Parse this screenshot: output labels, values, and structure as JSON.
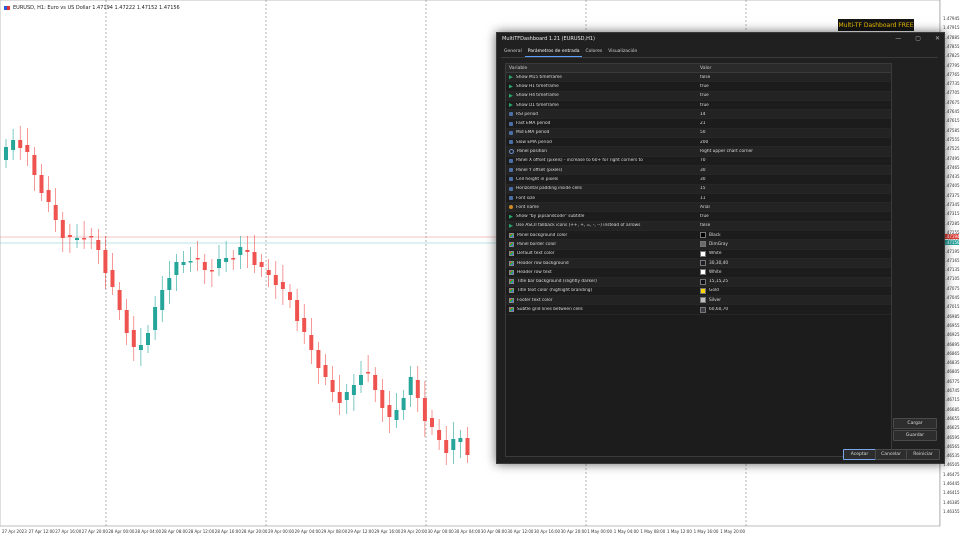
{
  "chart": {
    "header": "EURUSD, H1: Euro vs US Dollar  1.47194  1.47222  1.47152  1.47156",
    "promo": "Multi-TF Dashboard FREE",
    "price_labels": [
      "1.47945",
      "1.47915",
      "1.47885",
      "1.47855",
      "1.47825",
      "1.47795",
      "1.47765",
      "1.47735",
      "1.47705",
      "1.47675",
      "1.47645",
      "1.47615",
      "1.47585",
      "1.47555",
      "1.47525",
      "1.47495",
      "1.47465",
      "1.47435",
      "1.47405",
      "1.47375",
      "1.47345",
      "1.47315",
      "1.47285",
      "1.47255",
      "1.47225",
      "1.47195",
      "1.47165",
      "1.47135",
      "1.47105",
      "1.47075",
      "1.47045",
      "1.47015",
      "1.46985",
      "1.46955",
      "1.46925",
      "1.46895",
      "1.46865",
      "1.46835",
      "1.46805",
      "1.46775",
      "1.46745",
      "1.46715",
      "1.46685",
      "1.46655",
      "1.46625",
      "1.46595",
      "1.46565",
      "1.46535",
      "1.46505",
      "1.46475",
      "1.46445",
      "1.46415",
      "1.46385",
      "1.46355"
    ],
    "price_tags": [
      {
        "text": "1.47194",
        "color": "#e0403a"
      },
      {
        "text": "1.47156",
        "color": "#2aa6a0"
      }
    ],
    "time_labels": [
      "27 Apr 2023",
      "27 Apr 12:00",
      "27 Apr 16:00",
      "27 Apr 20:00",
      "28 Apr 00:00",
      "28 Apr 04:00",
      "28 Apr 08:00",
      "28 Apr 12:00",
      "28 Apr 16:00",
      "28 Apr 20:00",
      "29 Apr 00:00",
      "29 Apr 04:00",
      "29 Apr 08:00",
      "29 Apr 12:00",
      "29 Apr 16:00",
      "29 Apr 20:00",
      "30 Apr 00:00",
      "30 Apr 04:00",
      "30 Apr 08:00",
      "30 Apr 12:00",
      "30 Apr 16:00",
      "30 Apr 20:00",
      "1 May 00:00",
      "1 May 04:00",
      "1 May 08:00",
      "1 May 12:00",
      "1 May 16:00",
      "1 May 20:00"
    ],
    "colors": {
      "bull": "#26a69a",
      "bear": "#ef5350"
    }
  },
  "dialog": {
    "title": "MultiTFDashboard 1.21 (EURUSD,H1)",
    "controls": {
      "minimize": "—",
      "maximize": "▢",
      "close": "✕"
    },
    "tabs": [
      {
        "label": "General",
        "active": false
      },
      {
        "label": "Parámetros de entrada",
        "active": true
      },
      {
        "label": "Colores",
        "active": false
      },
      {
        "label": "Visualización",
        "active": false
      }
    ],
    "columns": {
      "variable": "Variable",
      "value": "Valor"
    },
    "rows": [
      {
        "name": "Show M15 timeframe",
        "value": "false",
        "icon": "bool"
      },
      {
        "name": "Show H1 timeframe",
        "value": "true",
        "icon": "bool"
      },
      {
        "name": "Show H4 timeframe",
        "value": "true",
        "icon": "bool"
      },
      {
        "name": "Show D1 timeframe",
        "value": "true",
        "icon": "bool"
      },
      {
        "name": "RSI period",
        "value": "14",
        "icon": "int"
      },
      {
        "name": "Fast EMA period",
        "value": "21",
        "icon": "int"
      },
      {
        "name": "Mid EMA period",
        "value": "50",
        "icon": "int"
      },
      {
        "name": "Slow EMA period",
        "value": "200",
        "icon": "int"
      },
      {
        "name": "Panel position",
        "value": "Right upper chart corner",
        "icon": "enum"
      },
      {
        "name": "Panel X offset (pixels) - increase to 60+ for right corners to",
        "value": "70",
        "icon": "int"
      },
      {
        "name": "Panel Y offset (pixels)",
        "value": "30",
        "icon": "int"
      },
      {
        "name": "Cell height in pixels",
        "value": "30",
        "icon": "int"
      },
      {
        "name": "Horizontal padding inside cells",
        "value": "15",
        "icon": "int"
      },
      {
        "name": "Font size",
        "value": "11",
        "icon": "int"
      },
      {
        "name": "Font name",
        "value": "Arial",
        "icon": "str"
      },
      {
        "name": "Show \"by pipsandcode\" subtitle",
        "value": "true",
        "icon": "bool"
      },
      {
        "name": "Use ASCII fallback icons (++, +, =, -, --) instead of arrows",
        "value": "false",
        "icon": "bool"
      },
      {
        "name": "Panel background color",
        "value": "Black",
        "icon": "color",
        "swatch": "#000000"
      },
      {
        "name": "Panel border color",
        "value": "DimGray",
        "icon": "color",
        "swatch": "#696969"
      },
      {
        "name": "Default text color",
        "value": "White",
        "icon": "color",
        "swatch": "#ffffff"
      },
      {
        "name": "Header row background",
        "value": "30,30,40",
        "icon": "color",
        "swatch": "#1e1e28"
      },
      {
        "name": "Header row text",
        "value": "White",
        "icon": "color",
        "swatch": "#ffffff"
      },
      {
        "name": "Title bar background (slightly darker)",
        "value": "15,15,25",
        "icon": "color",
        "swatch": "#0f0f19"
      },
      {
        "name": "Title text color (highlight branding)",
        "value": "Gold",
        "icon": "color",
        "swatch": "#ffd700"
      },
      {
        "name": "Footer text color",
        "value": "Silver",
        "icon": "color",
        "swatch": "#c0c0c0"
      },
      {
        "name": "Subtle grid lines between cells",
        "value": "60,60,70",
        "icon": "color",
        "swatch": "#3c3c46"
      }
    ],
    "buttons": {
      "load": "Cargar",
      "save": "Guardar",
      "ok": "Aceptar",
      "cancel": "Cancelar",
      "reset": "Reiniciar"
    }
  }
}
